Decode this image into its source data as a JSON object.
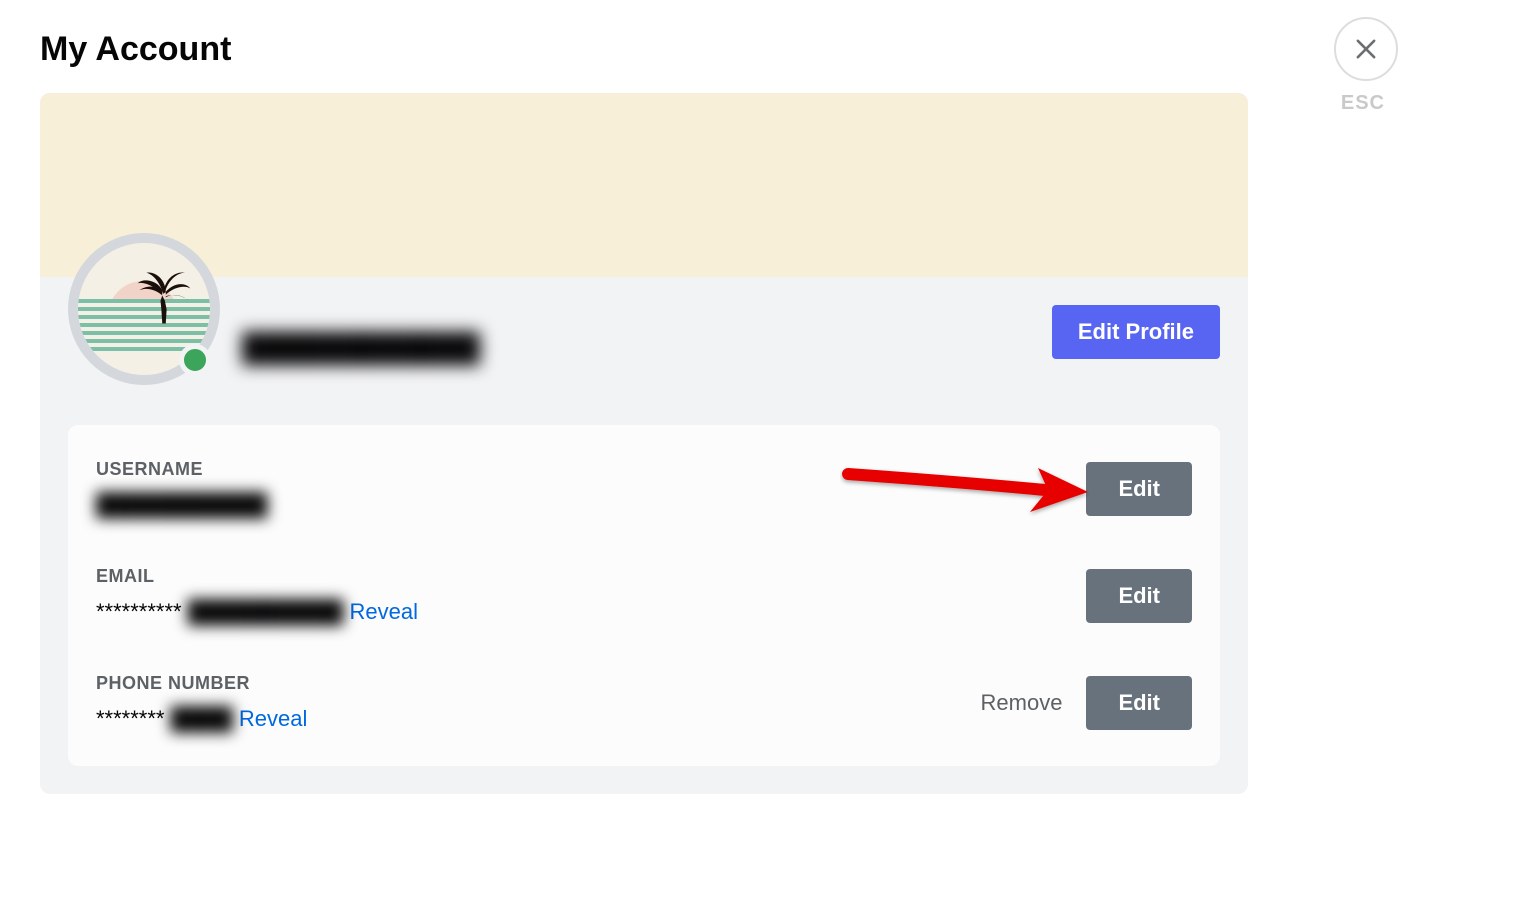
{
  "page": {
    "title": "My Account",
    "esc_label": "ESC"
  },
  "profile": {
    "display_name_blurred": "████████████",
    "edit_profile_label": "Edit Profile",
    "status": "online"
  },
  "details": {
    "username": {
      "label": "USERNAME",
      "value_blurred": "███████████",
      "edit_label": "Edit"
    },
    "email": {
      "label": "EMAIL",
      "masked_prefix": "**********",
      "value_blurred": "██████████",
      "reveal_label": "Reveal",
      "edit_label": "Edit"
    },
    "phone": {
      "label": "PHONE NUMBER",
      "masked_prefix": "********",
      "value_blurred": "████",
      "reveal_label": "Reveal",
      "remove_label": "Remove",
      "edit_label": "Edit"
    }
  }
}
